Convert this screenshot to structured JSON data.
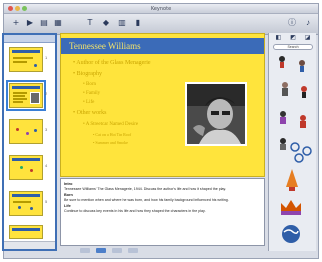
{
  "window": {
    "title": "Keynote"
  },
  "toolbar": {
    "buttons": [
      {
        "name": "new-slide",
        "icon": "plus-icon",
        "glyph": "+"
      },
      {
        "name": "play",
        "icon": "play-icon",
        "glyph": "▶"
      },
      {
        "name": "view",
        "icon": "view-icon",
        "glyph": "▤"
      },
      {
        "name": "masters",
        "icon": "masters-icon",
        "glyph": "▦"
      },
      {
        "name": "text-box",
        "icon": "text-icon",
        "glyph": "T"
      },
      {
        "name": "shapes",
        "icon": "shapes-icon",
        "glyph": "◆"
      },
      {
        "name": "table",
        "icon": "table-icon",
        "glyph": "▥"
      },
      {
        "name": "chart",
        "icon": "chart-icon",
        "glyph": "▮"
      }
    ],
    "right_buttons": [
      {
        "name": "inspector",
        "icon": "info-icon",
        "glyph": "ⓘ"
      },
      {
        "name": "media",
        "icon": "media-icon",
        "glyph": "♪"
      }
    ]
  },
  "slide": {
    "title": "Tennessee Williams",
    "bullets": [
      {
        "level": 1,
        "text": "Author of the Glass Menagerie"
      },
      {
        "level": 1,
        "text": "Biography"
      },
      {
        "level": 2,
        "text": "Born"
      },
      {
        "level": 2,
        "text": "Family"
      },
      {
        "level": 2,
        "text": "Life"
      },
      {
        "level": 1,
        "text": "Other works"
      },
      {
        "level": 2,
        "text": "A Streetcar Named Desire"
      },
      {
        "level": 3,
        "text": "Cat on a Hot Tin Roof"
      },
      {
        "level": 3,
        "text": "Summer and Smoke"
      }
    ]
  },
  "notes": {
    "paragraphs": [
      {
        "heading": "Intro",
        "text": "Tennessee Williams' The Glass Menagerie, 1944. Discuss the author's life and how it shaped the play."
      },
      {
        "heading": "Born",
        "text": "Be sure to mention when and where he was born, and how his family background influenced his writing."
      },
      {
        "heading": "Life",
        "text": "Continue to discuss key events in his life and how they shaped the characters in the play."
      }
    ]
  },
  "clipart": {
    "search_placeholder": "Search"
  },
  "colors": {
    "slide_bg": "#ffe43c",
    "title_bar": "#3b6bb8",
    "bullet_text": "#c9a400",
    "selection": "#3a7fd6"
  }
}
